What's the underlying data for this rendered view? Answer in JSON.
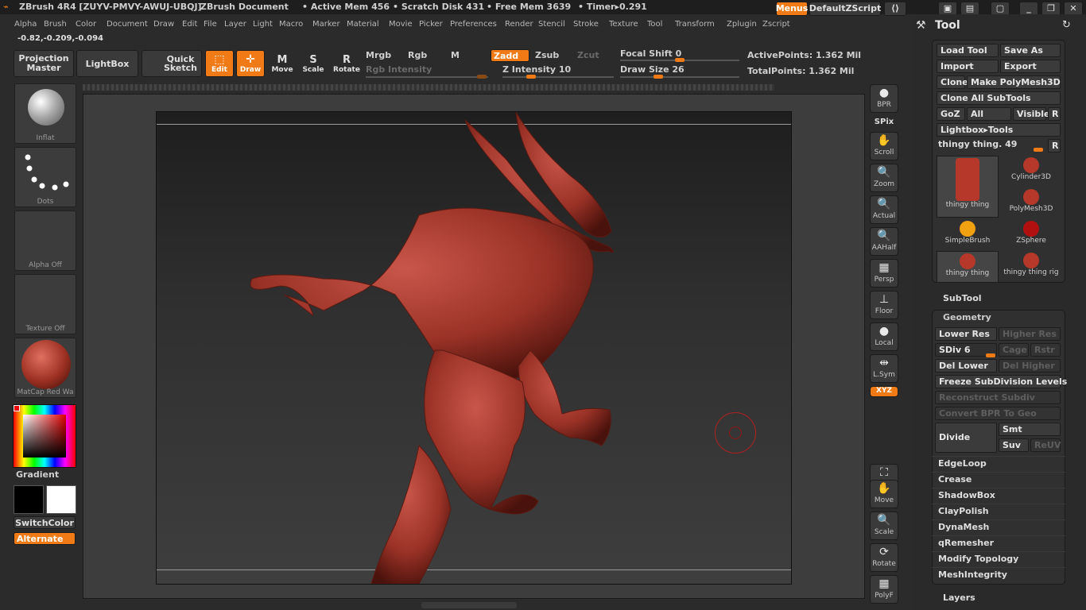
{
  "titlebar": {
    "app": "ZBrush 4R4 [ZUYV-PMVY-AWUJ-UBQJ]",
    "document": "ZBrush Document",
    "active_mem": "• Active Mem 456",
    "scratch": "• Scratch Disk 431",
    "free_mem": "• Free Mem 3639",
    "timer": "• Timer▸0.291",
    "menus_label": "Menus",
    "zscript_label": "DefaultZScript"
  },
  "coords": "-0.82,-0.209,-0.094",
  "menu": [
    "Alpha",
    "Brush",
    "Color",
    "Document",
    "Draw",
    "Edit",
    "File",
    "Layer",
    "Light",
    "Macro",
    "Marker",
    "Material",
    "Movie",
    "Picker",
    "Preferences",
    "Render",
    "Stencil",
    "Stroke",
    "Texture",
    "Tool",
    "Transform",
    "Zplugin",
    "Zscript"
  ],
  "toolbar": {
    "projection_master": "Projection Master",
    "lightbox": "LightBox",
    "quick_sketch": "Quick Sketch",
    "edit": "Edit",
    "draw": "Draw",
    "move": "Move",
    "scale": "Scale",
    "rotate": "Rotate",
    "mrgb": "Mrgb",
    "rgb": "Rgb",
    "m": "M",
    "zadd": "Zadd",
    "zsub": "Zsub",
    "zcut": "Zcut",
    "rgb_intensity": "Rgb Intensity",
    "z_intensity_label": "Z Intensity",
    "z_intensity": "10",
    "focal_shift_label": "Focal Shift",
    "focal_shift": "0",
    "draw_size_label": "Draw Size",
    "draw_size": "26",
    "active_points": "ActivePoints: 1.362 Mil",
    "total_points": "TotalPoints: 1.362 Mil"
  },
  "left_shelf": {
    "brush": "Inflat",
    "stroke": "Dots",
    "alpha": "Alpha Off",
    "texture": "Texture Off",
    "material": "MatCap Red Wa",
    "gradient": "Gradient",
    "switch_color": "SwitchColor",
    "alternate": "Alternate"
  },
  "right_shelf": [
    {
      "label": "BPR",
      "icon": "●"
    },
    {
      "label": "SPix",
      "icon": ""
    },
    {
      "label": "Scroll",
      "icon": "✋"
    },
    {
      "label": "Zoom",
      "icon": "🔍"
    },
    {
      "label": "Actual",
      "icon": "🔍"
    },
    {
      "label": "AAHalf",
      "icon": "🔍"
    },
    {
      "label": "Persp",
      "icon": "▦"
    },
    {
      "label": "Floor",
      "icon": "⊥"
    },
    {
      "label": "Local",
      "icon": "●"
    },
    {
      "label": "L.Sym",
      "icon": "⇹"
    },
    {
      "label": "XYZ",
      "icon": ""
    },
    {
      "label": "Frame",
      "icon": "⛶"
    },
    {
      "label": "Move",
      "icon": "✋"
    },
    {
      "label": "Scale",
      "icon": "🔍"
    },
    {
      "label": "Rotate",
      "icon": "⟳"
    },
    {
      "label": "PolyF",
      "icon": "▦"
    }
  ],
  "tool_panel": {
    "title": "Tool",
    "load_tool": "Load Tool",
    "save_as": "Save As",
    "import": "Import",
    "export": "Export",
    "clone": "Clone",
    "make_polymesh": "Make PolyMesh3D",
    "clone_all": "Clone All SubTools",
    "goz": "GoZ",
    "all": "All",
    "visible": "Visible",
    "r": "R",
    "lightbox_tools": "Lightbox▸Tools",
    "current_tool": "thingy thing. 49",
    "tools": [
      {
        "name": "thingy thing",
        "color": "#b5382a"
      },
      {
        "name": "Cylinder3D",
        "color": "#b5382a"
      },
      {
        "name": "PolyMesh3D",
        "color": "#b5382a"
      },
      {
        "name": "SimpleBrush",
        "color": "#f0a010"
      },
      {
        "name": "ZSphere",
        "color": "#b01010"
      },
      {
        "name": "thingy thing",
        "color": "#b5382a"
      },
      {
        "name": "thingy thing rig",
        "color": "#b5382a"
      }
    ],
    "subtool": "SubTool",
    "geometry": "Geometry",
    "lower_res": "Lower Res",
    "higher_res": "Higher Res",
    "sdiv_label": "SDiv",
    "sdiv": "6",
    "cage": "Cage",
    "rstr": "Rstr",
    "del_lower": "Del Lower",
    "del_higher": "Del Higher",
    "freeze": "Freeze SubDivision Levels",
    "reconstruct": "Reconstruct Subdiv",
    "convert_bpr": "Convert BPR To Geo",
    "divide": "Divide",
    "smt": "Smt",
    "suv": "Suv",
    "reuv": "ReUV",
    "sections": [
      "EdgeLoop",
      "Crease",
      "ShadowBox",
      "ClayPolish",
      "DynaMesh",
      "qRemesher",
      "Modify Topology",
      "MeshIntegrity"
    ],
    "layers": "Layers"
  },
  "colors": {
    "accent": "#f07b16",
    "model": "#a8372b"
  }
}
